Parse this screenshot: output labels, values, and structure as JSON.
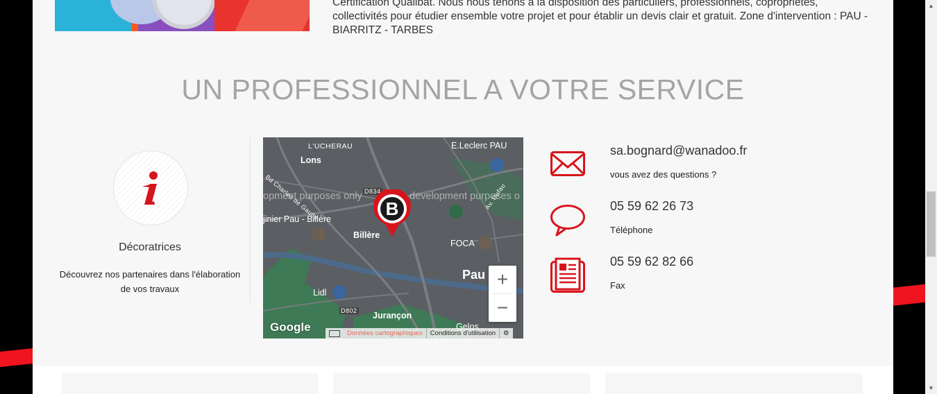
{
  "intro": {
    "text": "Certification Qualibat. Nous nous tenons à la disposition des particuliers, professionnels, copropriétés, collectivités pour étudier ensemble votre projet et pour établir un devis clair et gratuit. Zone d'intervention : PAU - BIARRITZ - TARBES"
  },
  "section": {
    "title": "UN PROFESSIONNEL A VOTRE SERVICE"
  },
  "decoratrices": {
    "title": "Décoratrices",
    "description": "Découvrez nos partenaires dans l'élaboration de vos travaux",
    "icon": "info-icon"
  },
  "map": {
    "labels": {
      "lucherau": "L'UCHERAU",
      "leclerc": "E.Leclerc PAU",
      "lons": "Lons",
      "road": "Bd Charles de Gaulle",
      "d834": "D834",
      "pau_billere": "jinier Pau - Billère",
      "billere": "Billère",
      "foca": "FOCA",
      "pau": "Pau",
      "lidl": "Lidl",
      "d802": "D802",
      "jurancon": "Jurançon",
      "gelos": "Gelos",
      "av": "Av. Dufau"
    },
    "dev_text_1": "opment purposes only",
    "dev_text_2": "development purposes o",
    "marker_letter": "B",
    "zoom_in": "+",
    "zoom_out": "−",
    "google": "Google",
    "attribution_data": "Données cartographiques",
    "attribution_terms": "Conditions d'utilisation"
  },
  "contacts": [
    {
      "icon": "envelope-icon",
      "main": "sa.bognard@wanadoo.fr",
      "sub": "vous avez des questions ?"
    },
    {
      "icon": "speech-bubble-icon",
      "main": "05 59 62 26 73",
      "sub": "Téléphone"
    },
    {
      "icon": "fax-icon",
      "main": "05 59 62 82 66",
      "sub": "Fax"
    }
  ],
  "colors": {
    "accent": "#d7141c",
    "title_gray": "#a4a4a4",
    "map_bg": "#5b5e62"
  }
}
